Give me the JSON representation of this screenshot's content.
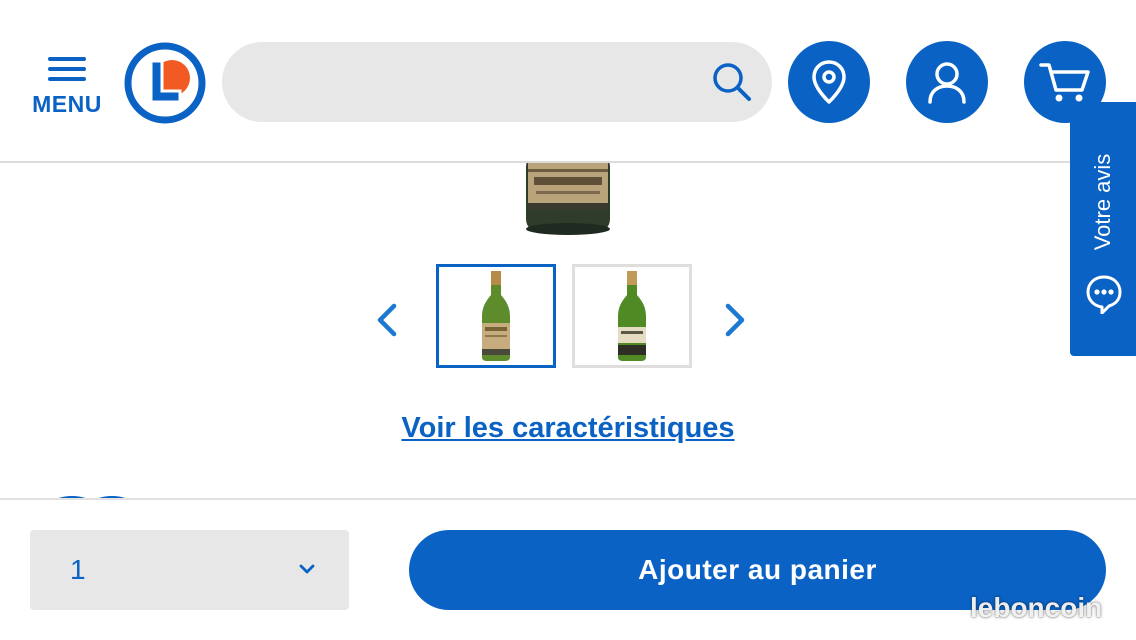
{
  "header": {
    "menu_label": "MENU",
    "search": {
      "placeholder": "",
      "value": ""
    }
  },
  "product": {
    "characteristics_link": "Voir les caractéristiques",
    "thumbnails": [
      {
        "name": "thumbnail-1",
        "selected": true
      },
      {
        "name": "thumbnail-2",
        "selected": false
      }
    ]
  },
  "purchase": {
    "quantity": "1",
    "add_to_cart_label": "Ajouter au panier"
  },
  "feedback": {
    "label": "Votre avis"
  },
  "icons": {
    "menu": "hamburger-icon",
    "logo": "leclerc-logo",
    "search": "search-icon",
    "location": "location-pin-icon",
    "account": "user-icon",
    "cart": "cart-icon",
    "prev": "chevron-left-icon",
    "next": "chevron-right-icon",
    "quantity": "chevron-down-icon",
    "feedback": "chat-bubble-icon"
  },
  "colors": {
    "brand_blue": "#0a62c4",
    "logo_orange": "#f15a22",
    "field_gray": "#e7e7e7"
  },
  "watermark": "leboncoin"
}
